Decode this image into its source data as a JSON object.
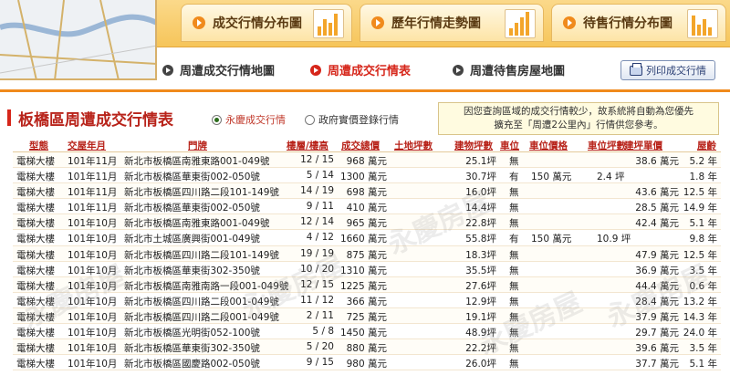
{
  "tabs": [
    {
      "label": "成交行情分布圖"
    },
    {
      "label": "歷年行情走勢圖"
    },
    {
      "label": "待售行情分布圖"
    }
  ],
  "subnav": [
    {
      "label": "周遭成交行情地圖"
    },
    {
      "label": "周遭成交行情表"
    },
    {
      "label": "周遭待售房屋地圖"
    }
  ],
  "print_label": "列印成交行情",
  "section": {
    "title": "板橋區周遭成交行情表",
    "radio_1": "永慶成交行情",
    "radio_2": "政府實價登錄行情",
    "notice_line1": "因您查詢區域的成交行情較少，故系統將自動為您優先",
    "notice_line2": "擴充至「周遭2公里內」行情供您參考。"
  },
  "table": {
    "headers": [
      "型態",
      "交屋年月",
      "門牌",
      "樓層/樓高",
      "成交總價",
      "土地坪數",
      "建物坪數",
      "車位",
      "車位價格",
      "車位坪數",
      "建坪單價",
      "屋齡"
    ],
    "rows": [
      [
        "電梯大樓",
        "101年11月",
        "新北市板橋區南雅東路001-049號",
        "12 / 15",
        "968 萬元",
        "",
        "25.1坪",
        "無",
        "",
        "",
        "38.6 萬元",
        "5.2 年"
      ],
      [
        "電梯大樓",
        "101年11月",
        "新北市板橋區華東街002-050號",
        "5 / 14",
        "1300 萬元",
        "",
        "30.7坪",
        "有",
        "150 萬元",
        "2.4 坪",
        "",
        "1.8 年"
      ],
      [
        "電梯大樓",
        "101年11月",
        "新北市板橋區四川路二段101-149號",
        "14 / 19",
        "698 萬元",
        "",
        "16.0坪",
        "無",
        "",
        "",
        "43.6 萬元",
        "12.5 年"
      ],
      [
        "電梯大樓",
        "101年11月",
        "新北市板橋區華東街002-050號",
        "9 / 11",
        "410 萬元",
        "",
        "14.4坪",
        "無",
        "",
        "",
        "28.5 萬元",
        "14.9 年"
      ],
      [
        "電梯大樓",
        "101年10月",
        "新北市板橋區南雅東路001-049號",
        "12 / 14",
        "965 萬元",
        "",
        "22.8坪",
        "無",
        "",
        "",
        "42.4 萬元",
        "5.1 年"
      ],
      [
        "電梯大樓",
        "101年10月",
        "新北市土城區廣興街001-049號",
        "4 / 12",
        "1660 萬元",
        "",
        "55.8坪",
        "有",
        "150 萬元",
        "10.9 坪",
        "",
        "9.8 年"
      ],
      [
        "電梯大樓",
        "101年10月",
        "新北市板橋區四川路二段101-149號",
        "19 / 19",
        "875 萬元",
        "",
        "18.3坪",
        "無",
        "",
        "",
        "47.9 萬元",
        "12.5 年"
      ],
      [
        "電梯大樓",
        "101年10月",
        "新北市板橋區華東街302-350號",
        "10 / 20",
        "1310 萬元",
        "",
        "35.5坪",
        "無",
        "",
        "",
        "36.9 萬元",
        "3.5 年"
      ],
      [
        "電梯大樓",
        "101年10月",
        "新北市板橋區南雅南路一段001-049號",
        "12 / 15",
        "1225 萬元",
        "",
        "27.6坪",
        "無",
        "",
        "",
        "44.4 萬元",
        "0.6 年"
      ],
      [
        "電梯大樓",
        "101年10月",
        "新北市板橋區四川路二段001-049號",
        "11 / 12",
        "366 萬元",
        "",
        "12.9坪",
        "無",
        "",
        "",
        "28.4 萬元",
        "13.2 年"
      ],
      [
        "電梯大樓",
        "101年10月",
        "新北市板橋區四川路二段001-049號",
        "2 / 11",
        "725 萬元",
        "",
        "19.1坪",
        "無",
        "",
        "",
        "37.9 萬元",
        "14.3 年"
      ],
      [
        "電梯大樓",
        "101年10月",
        "新北市板橋區光明街052-100號",
        "5 / 8",
        "1450 萬元",
        "",
        "48.9坪",
        "無",
        "",
        "",
        "29.7 萬元",
        "24.0 年"
      ],
      [
        "電梯大樓",
        "101年10月",
        "新北市板橋區華東街302-350號",
        "5 / 20",
        "880 萬元",
        "",
        "22.2坪",
        "無",
        "",
        "",
        "39.6 萬元",
        "3.5 年"
      ],
      [
        "電梯大樓",
        "101年10月",
        "新北市板橋區國慶路002-050號",
        "9 / 15",
        "980 萬元",
        "",
        "26.0坪",
        "無",
        "",
        "",
        "37.7 萬元",
        "5.1 年"
      ]
    ]
  },
  "watermark": "永慶房屋"
}
